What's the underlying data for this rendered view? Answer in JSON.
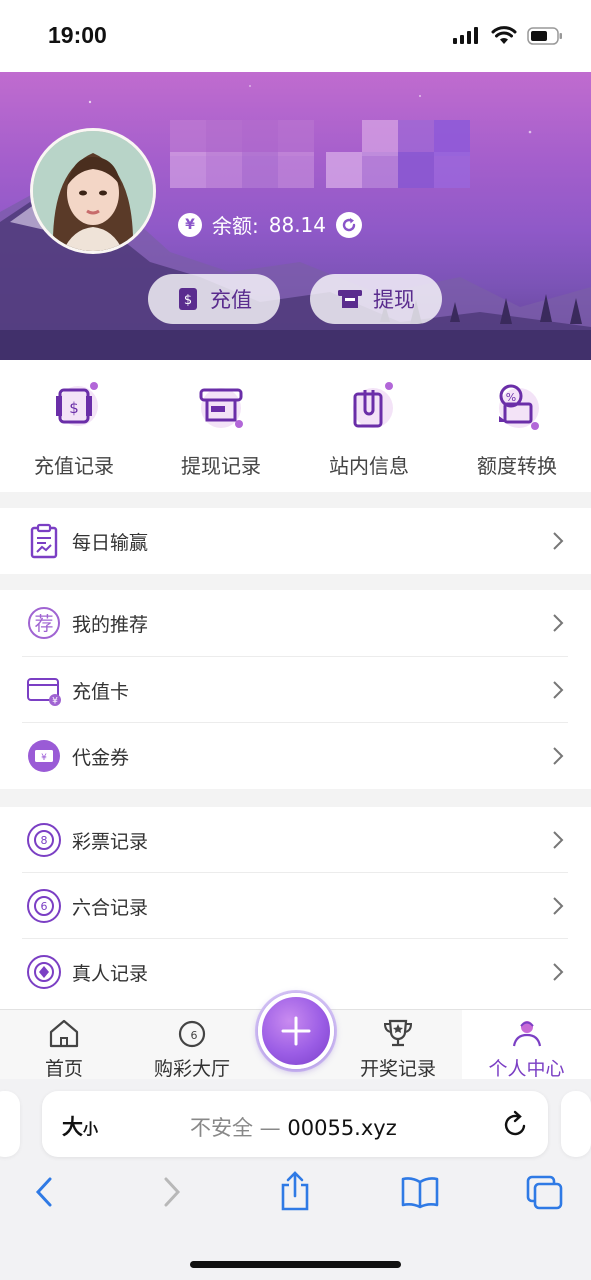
{
  "status_bar": {
    "time": "19:00"
  },
  "header": {
    "balance_label": "余额:",
    "balance_value": "88.14",
    "yen_symbol": "¥",
    "recharge_label": "充值",
    "withdraw_label": "提现"
  },
  "quick_actions": [
    {
      "label": "充值记录",
      "icon": "deposit-record-icon"
    },
    {
      "label": "提现记录",
      "icon": "withdraw-record-icon"
    },
    {
      "label": "站内信息",
      "icon": "message-icon"
    },
    {
      "label": "额度转换",
      "icon": "quota-transfer-icon"
    }
  ],
  "menu": {
    "daily": "每日输赢",
    "referral": "我的推荐",
    "recharge_card": "充值卡",
    "voucher": "代金券",
    "lottery_record": "彩票记录",
    "liuhe_record": "六合记录",
    "live_record": "真人记录",
    "referral_glyph": "荐"
  },
  "tabbar": {
    "home": "首页",
    "hall": "购彩大厅",
    "draw": "开奖记录",
    "profile": "个人中心"
  },
  "browser": {
    "text_size_big": "大",
    "text_size_small": "小",
    "insecure_label": "不安全 —",
    "domain": "00055.xyz"
  },
  "colors": {
    "accent": "#7b3fc4",
    "header_top": "#c06ccf",
    "header_bottom": "#5b3f8c"
  }
}
